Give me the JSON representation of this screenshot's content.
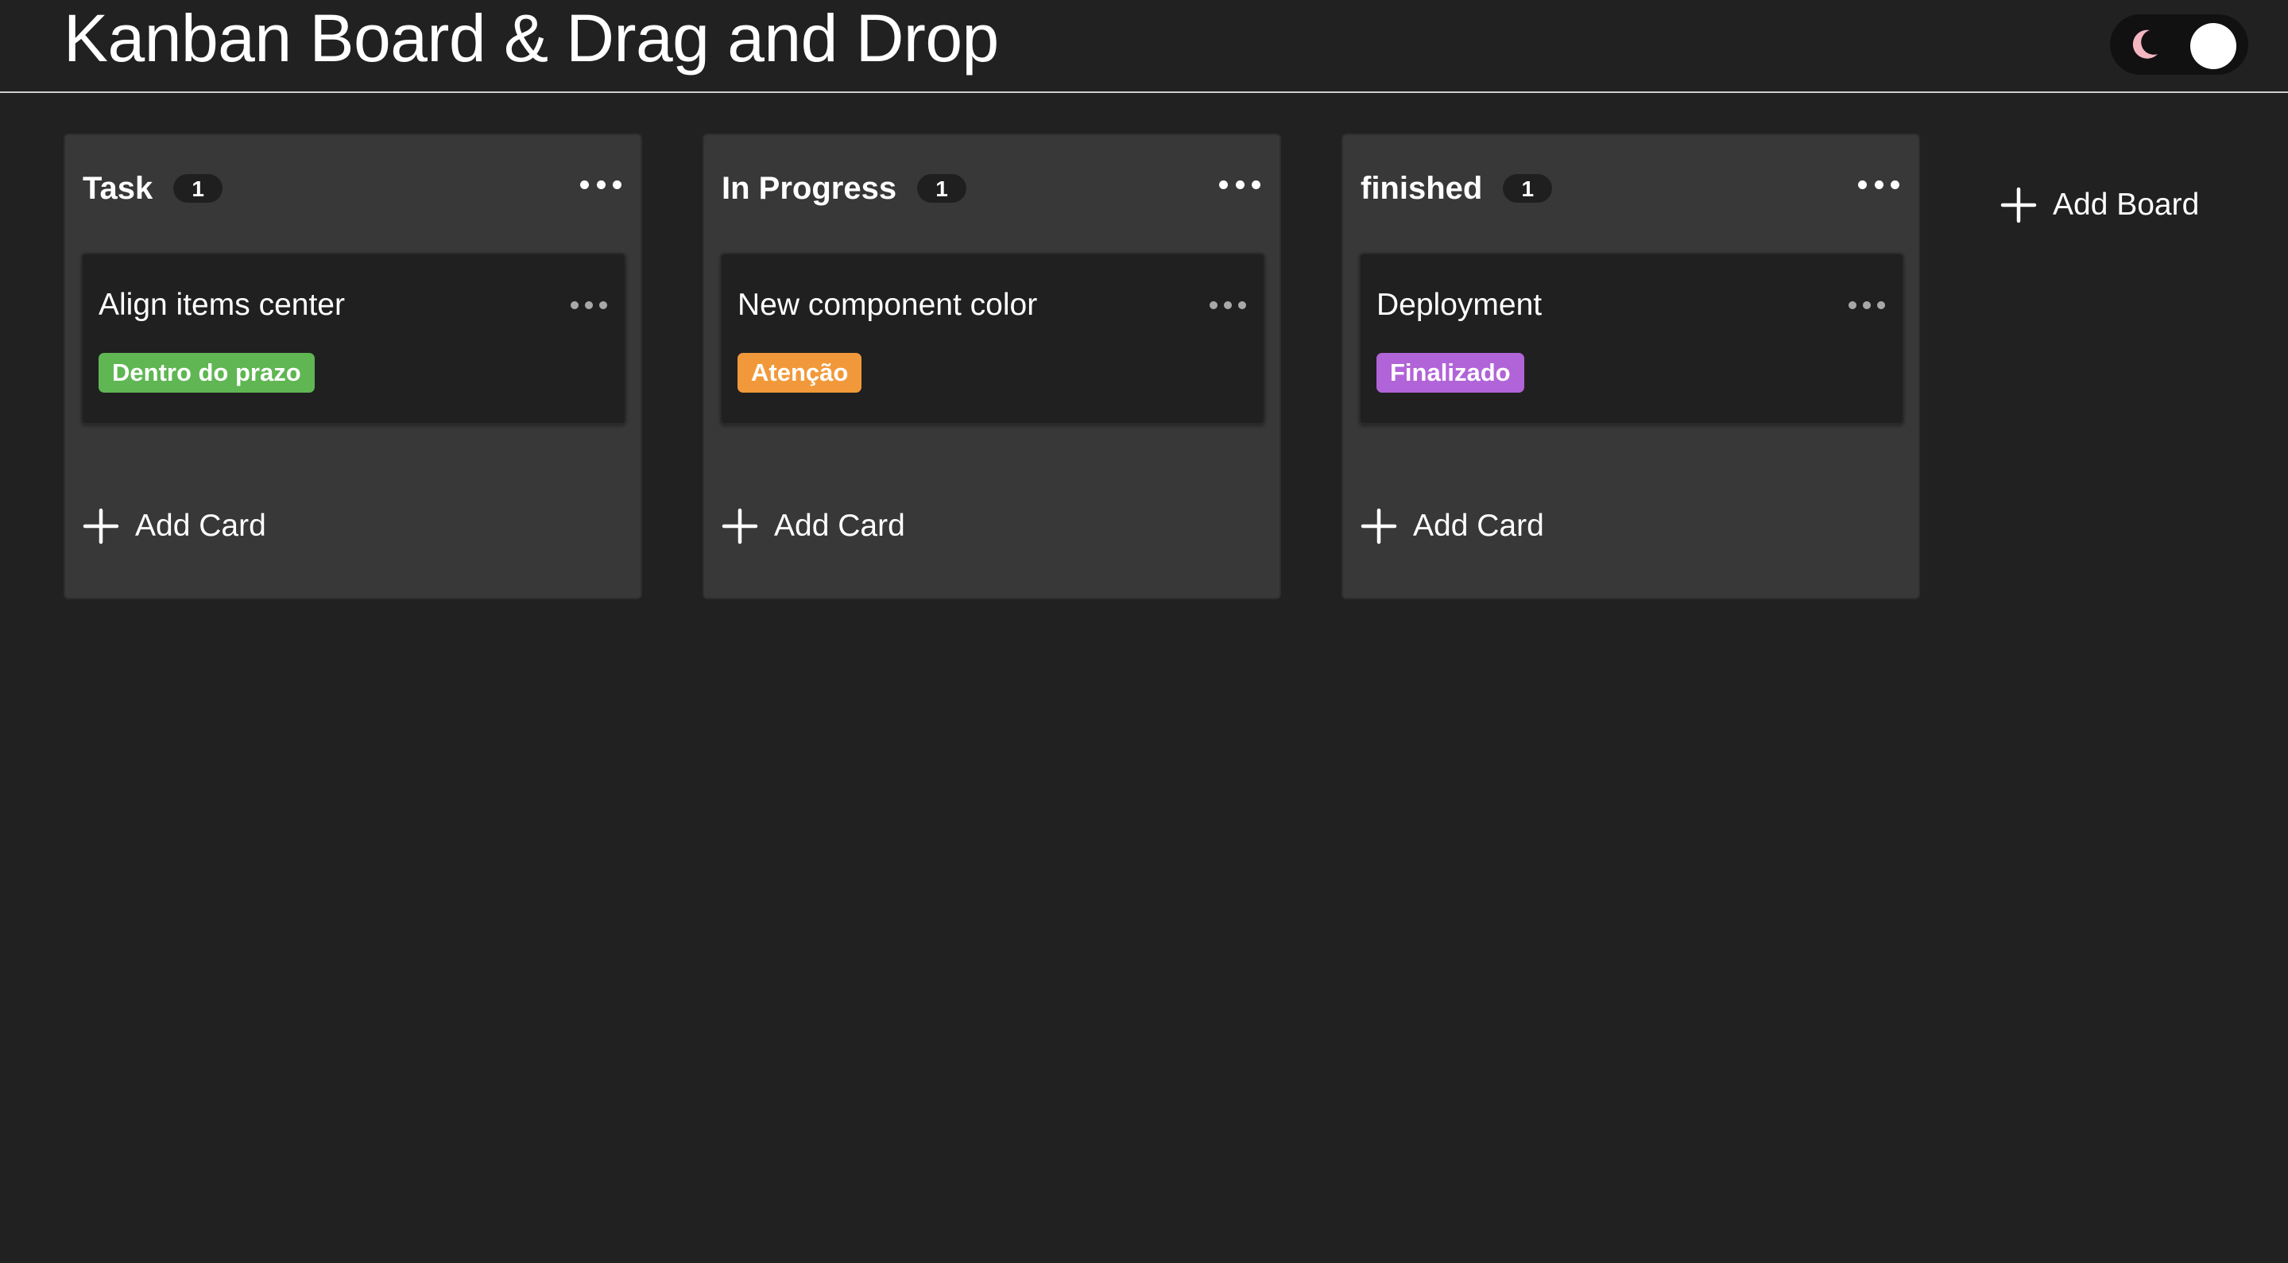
{
  "header": {
    "title": "Kanban Board & Drag and Drop",
    "theme_toggle": {
      "mode": "dark",
      "icon": "moon-icon",
      "icon_color": "#f4b6c1"
    }
  },
  "boards": [
    {
      "title": "Task",
      "count": "1",
      "cards": [
        {
          "title": "Align items center",
          "tag": "Dentro do prazo",
          "tag_color": "#5fb653"
        }
      ],
      "add_card_label": "Add Card"
    },
    {
      "title": "In Progress",
      "count": "1",
      "cards": [
        {
          "title": "New component color",
          "tag": "Atenção",
          "tag_color": "#f1993a"
        }
      ],
      "add_card_label": "Add Card"
    },
    {
      "title": "finished",
      "count": "1",
      "cards": [
        {
          "title": "Deployment",
          "tag": "Finalizado",
          "tag_color": "#b164d8"
        }
      ],
      "add_card_label": "Add Card"
    }
  ],
  "add_board": {
    "label": "Add Board",
    "icon": "plus-icon"
  },
  "colors": {
    "background": "#212121",
    "board_background": "#383838",
    "card_background": "#202020",
    "text": "#ffffff"
  }
}
